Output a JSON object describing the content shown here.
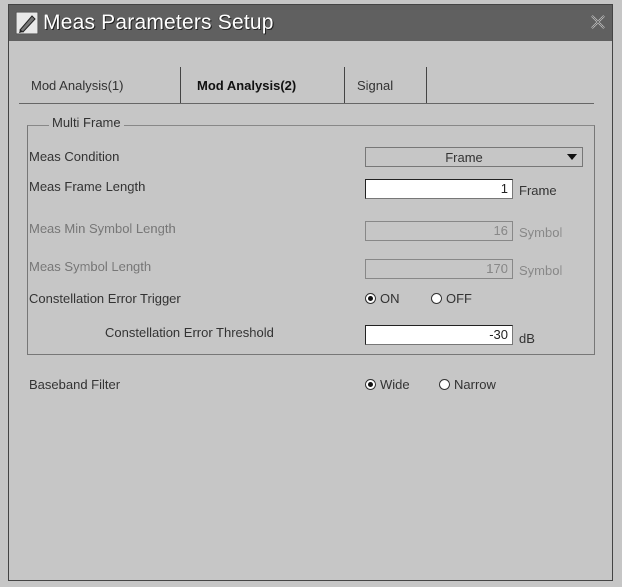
{
  "window": {
    "title": "Meas Parameters Setup"
  },
  "tabs": [
    {
      "label": "Mod Analysis(1)",
      "active": false
    },
    {
      "label": "Mod Analysis(2)",
      "active": true
    },
    {
      "label": "Signal",
      "active": false
    }
  ],
  "group": {
    "title": "Multi Frame",
    "meas_condition": {
      "label": "Meas Condition",
      "value": "Frame"
    },
    "frame_length": {
      "label": "Meas Frame Length",
      "value": "1",
      "unit": "Frame"
    },
    "min_symbol_length": {
      "label": "Meas Min Symbol Length",
      "value": "16",
      "unit": "Symbol"
    },
    "symbol_length": {
      "label": "Meas Symbol Length",
      "value": "170",
      "unit": "Symbol"
    },
    "constellation_trigger": {
      "label": "Constellation Error Trigger",
      "on_label": "ON",
      "off_label": "OFF",
      "selected": "ON"
    },
    "constellation_threshold": {
      "label": "Constellation Error Threshold",
      "value": "-30",
      "unit": "dB"
    }
  },
  "baseband_filter": {
    "label": "Baseband Filter",
    "wide_label": "Wide",
    "narrow_label": "Narrow",
    "selected": "Wide"
  },
  "icons": {
    "title": "pencil-icon",
    "close": "close-icon",
    "dropdown": "chevron-down-icon"
  }
}
